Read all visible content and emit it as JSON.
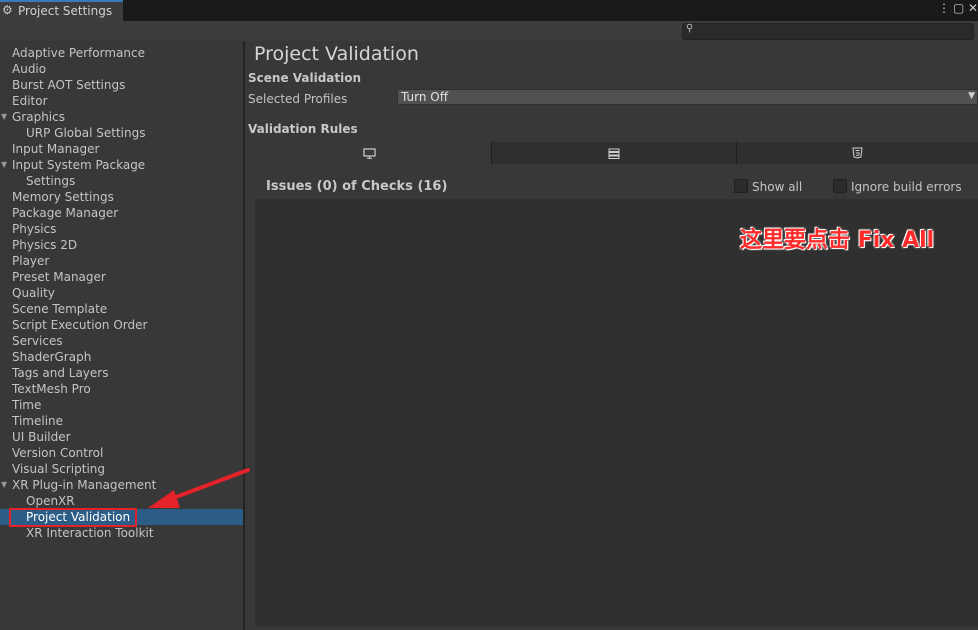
{
  "window": {
    "title": "Project Settings",
    "tab_icon": "gear-icon",
    "controls": [
      "more-icon",
      "maximize-icon",
      "close-icon"
    ]
  },
  "search": {
    "placeholder": "",
    "icon": "search-icon"
  },
  "sidebar": {
    "selected_color": "#2c5d87",
    "items": [
      {
        "label": "Adaptive Performance",
        "level": 0,
        "expandable": false
      },
      {
        "label": "Audio",
        "level": 0,
        "expandable": false
      },
      {
        "label": "Burst AOT Settings",
        "level": 0,
        "expandable": false
      },
      {
        "label": "Editor",
        "level": 0,
        "expandable": false
      },
      {
        "label": "Graphics",
        "level": 0,
        "expandable": true
      },
      {
        "label": "URP Global Settings",
        "level": 1,
        "expandable": false
      },
      {
        "label": "Input Manager",
        "level": 0,
        "expandable": false
      },
      {
        "label": "Input System Package",
        "level": 0,
        "expandable": true
      },
      {
        "label": "Settings",
        "level": 1,
        "expandable": false
      },
      {
        "label": "Memory Settings",
        "level": 0,
        "expandable": false
      },
      {
        "label": "Package Manager",
        "level": 0,
        "expandable": false
      },
      {
        "label": "Physics",
        "level": 0,
        "expandable": false
      },
      {
        "label": "Physics 2D",
        "level": 0,
        "expandable": false
      },
      {
        "label": "Player",
        "level": 0,
        "expandable": false
      },
      {
        "label": "Preset Manager",
        "level": 0,
        "expandable": false
      },
      {
        "label": "Quality",
        "level": 0,
        "expandable": false
      },
      {
        "label": "Scene Template",
        "level": 0,
        "expandable": false
      },
      {
        "label": "Script Execution Order",
        "level": 0,
        "expandable": false
      },
      {
        "label": "Services",
        "level": 0,
        "expandable": false
      },
      {
        "label": "ShaderGraph",
        "level": 0,
        "expandable": false
      },
      {
        "label": "Tags and Layers",
        "level": 0,
        "expandable": false
      },
      {
        "label": "TextMesh Pro",
        "level": 0,
        "expandable": false
      },
      {
        "label": "Time",
        "level": 0,
        "expandable": false
      },
      {
        "label": "Timeline",
        "level": 0,
        "expandable": false
      },
      {
        "label": "UI Builder",
        "level": 0,
        "expandable": false
      },
      {
        "label": "Version Control",
        "level": 0,
        "expandable": false
      },
      {
        "label": "Visual Scripting",
        "level": 0,
        "expandable": false
      },
      {
        "label": "XR Plug-in Management",
        "level": 0,
        "expandable": true
      },
      {
        "label": "OpenXR",
        "level": 1,
        "expandable": false
      },
      {
        "label": "Project Validation",
        "level": 1,
        "expandable": false,
        "selected": true
      },
      {
        "label": "XR Interaction Toolkit",
        "level": 1,
        "expandable": false
      }
    ]
  },
  "main": {
    "title": "Project Validation",
    "scene_validation": {
      "heading": "Scene Validation",
      "profiles_label": "Selected Profiles",
      "profiles_value": "Turn Off"
    },
    "validation_rules": {
      "heading": "Validation Rules",
      "tabs": [
        {
          "icon": "monitor-icon",
          "active": true
        },
        {
          "icon": "server-icon",
          "active": false
        },
        {
          "icon": "html5-icon",
          "active": false
        }
      ],
      "issues_summary": "Issues (0) of Checks (16)",
      "show_all_label": "Show all",
      "show_all_checked": false,
      "ignore_errors_label": "Ignore build errors",
      "ignore_errors_checked": false
    }
  },
  "annotation": {
    "text": "这里要点击 Fix All",
    "color": "#ff2a2a"
  }
}
